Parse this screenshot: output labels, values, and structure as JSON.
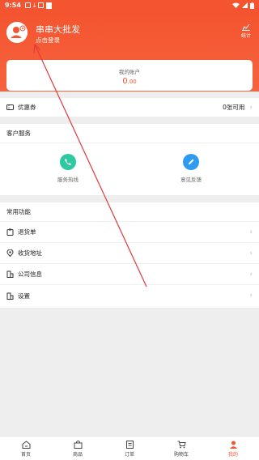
{
  "status_bar": {
    "time": "9:54"
  },
  "header": {
    "shop_name": "串串大批发",
    "login_text": "点击登录",
    "stats_label": "统计"
  },
  "account": {
    "label": "我的账户",
    "balance_int": "0",
    "balance_dec": ".00"
  },
  "coupon": {
    "label": "优惠券",
    "value": "0张可用"
  },
  "customer_service": {
    "title": "客户服务",
    "items": [
      {
        "label": "服务热线"
      },
      {
        "label": "意见反馈"
      }
    ]
  },
  "common_functions": {
    "title": "常用功能",
    "items": [
      {
        "label": "退货单"
      },
      {
        "label": "收货地址"
      },
      {
        "label": "公司信息"
      },
      {
        "label": "设置"
      }
    ]
  },
  "tabbar": {
    "items": [
      {
        "label": "首页"
      },
      {
        "label": "商品"
      },
      {
        "label": "订单"
      },
      {
        "label": "购物车"
      },
      {
        "label": "我的"
      }
    ]
  },
  "colors": {
    "accent": "#f4542f",
    "service_green": "#2ec9a0",
    "feedback_blue": "#2f9bf0"
  }
}
